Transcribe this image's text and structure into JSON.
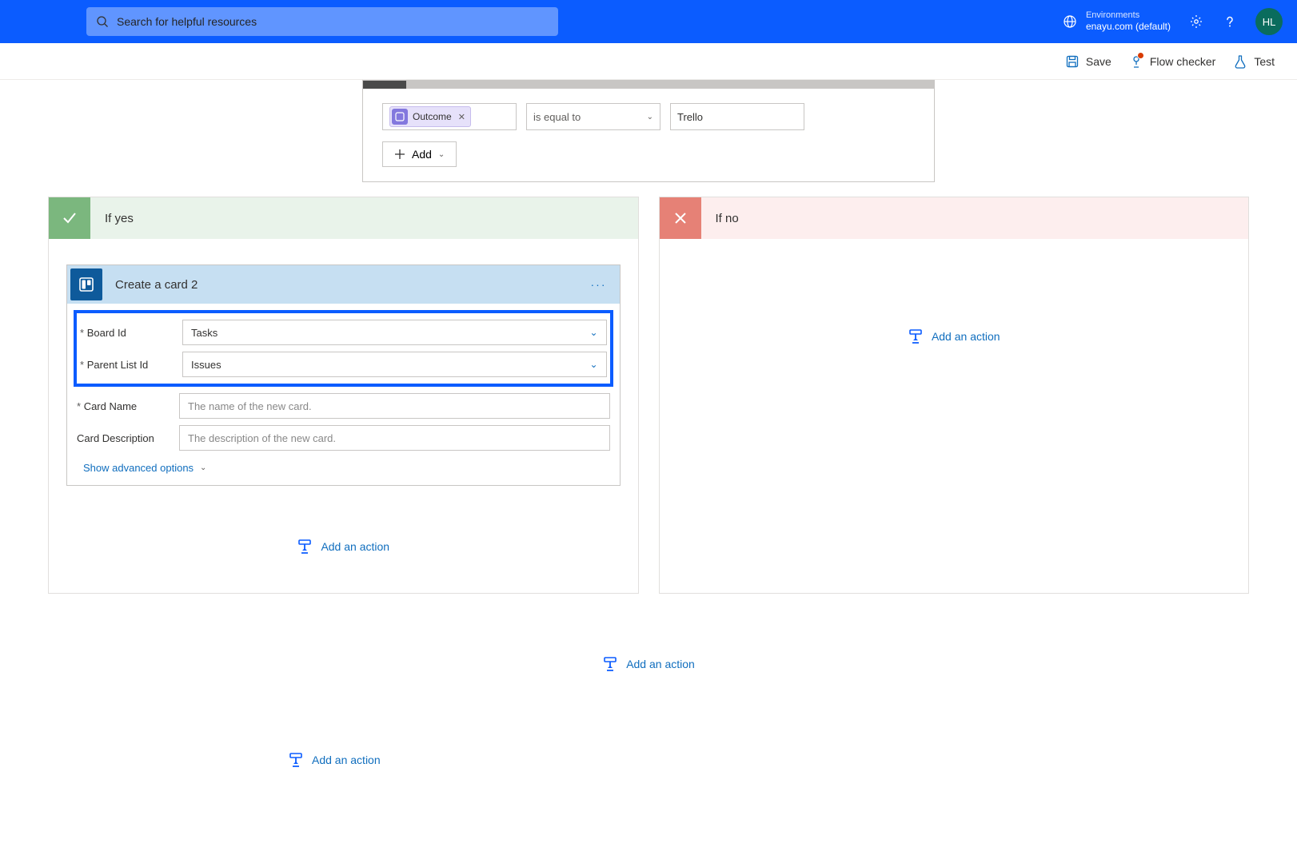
{
  "header": {
    "search_placeholder": "Search for helpful resources",
    "env_label": "Environments",
    "env_value": "enayu.com (default)",
    "avatar_initials": "HL"
  },
  "toolbar": {
    "save_label": "Save",
    "flow_checker_label": "Flow checker",
    "test_label": "Test"
  },
  "condition": {
    "token_label": "Outcome",
    "operator_label": "is equal to",
    "value_label": "Trello",
    "add_label": "Add"
  },
  "branches": {
    "yes_label": "If yes",
    "no_label": "If no"
  },
  "action_card": {
    "title": "Create a card 2",
    "fields": {
      "board_id_label": "Board Id",
      "board_id_value": "Tasks",
      "parent_list_label": "Parent List Id",
      "parent_list_value": "Issues",
      "card_name_label": "Card Name",
      "card_name_placeholder": "The name of the new card.",
      "card_desc_label": "Card Description",
      "card_desc_placeholder": "The description of the new card."
    },
    "advanced_label": "Show advanced options"
  },
  "add_action_label": "Add an action"
}
